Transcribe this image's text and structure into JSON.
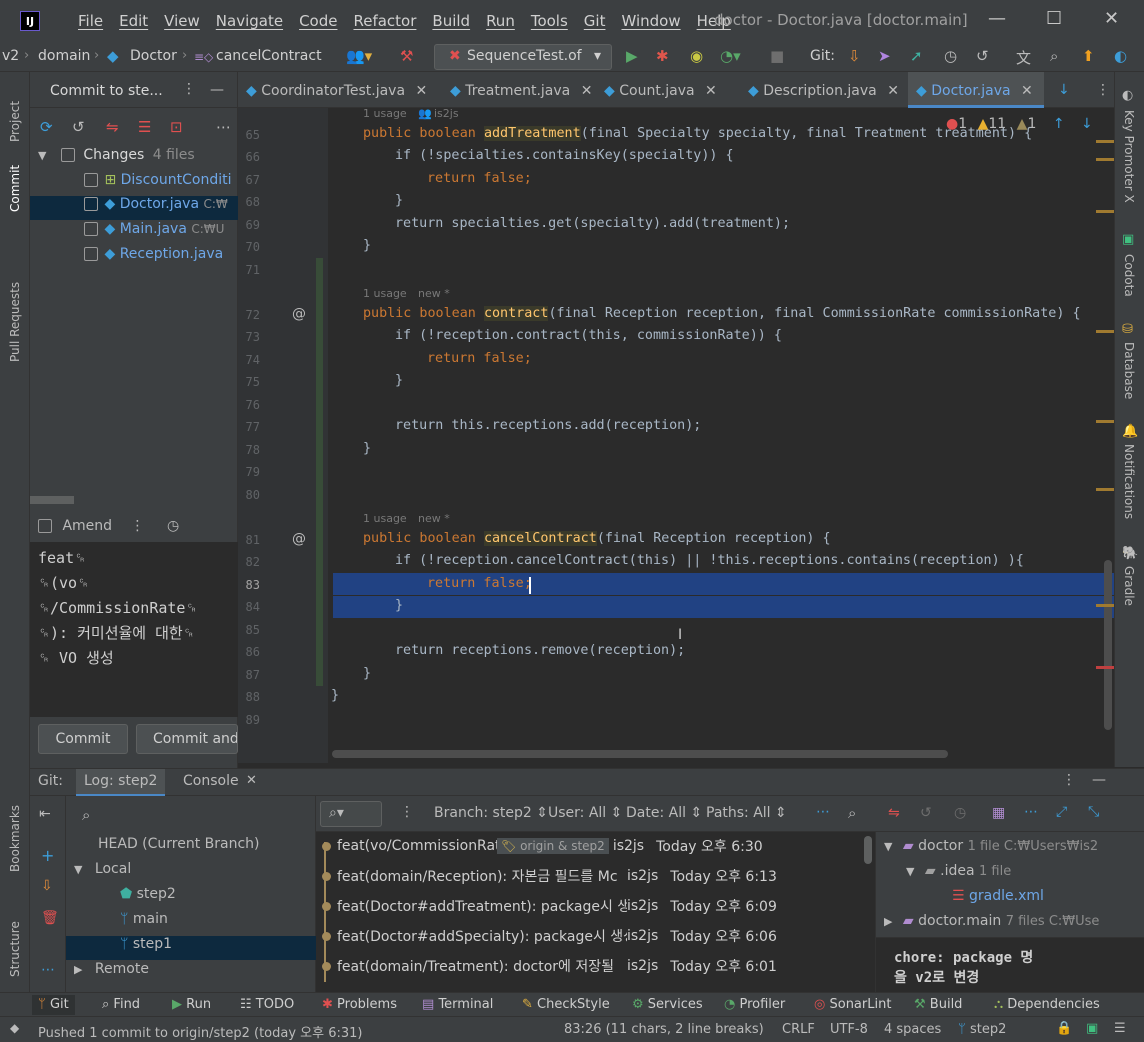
{
  "menu": [
    "File",
    "Edit",
    "View",
    "Navigate",
    "Code",
    "Refactor",
    "Build",
    "Run",
    "Tools",
    "Git",
    "Window",
    "Help"
  ],
  "window_title": "doctor - Doctor.java [doctor.main]",
  "breadcrumbs": [
    "v2",
    "domain",
    "Doctor",
    "cancelContract"
  ],
  "run_config": "SequenceTest.of",
  "git_label": "Git:",
  "left_strip": [
    "Project",
    "Commit",
    "Pull Requests",
    "Bookmarks",
    "Structure"
  ],
  "right_strip": [
    "Key Promoter X",
    "Codota",
    "Database",
    "Notifications",
    "Gradle"
  ],
  "commit_panel": {
    "title": "Commit to ste...",
    "changes_label": "Changes",
    "changes_count": "4 files",
    "files": [
      {
        "name": "DiscountConditi",
        "path": ""
      },
      {
        "name": "Doctor.java",
        "path": "C:₩"
      },
      {
        "name": "Main.java",
        "path": "C:₩U"
      },
      {
        "name": "Reception.java",
        "path": ""
      }
    ],
    "amend_label": "Amend",
    "message_lines": [
      "feat␍",
      "␍(vo␍",
      "␍/CommissionRate␍",
      "␍): 커미션율에 대한␍",
      "␍ VO 생성"
    ],
    "commit_button": "Commit",
    "commit_push_button": "Commit and"
  },
  "tabs": [
    "CoordinatorTest.java",
    "Treatment.java",
    "Count.java",
    "Description.java",
    "Doctor.java"
  ],
  "inspections": {
    "errors": "1",
    "warnings": "11",
    "weak": "1"
  },
  "code": {
    "line_numbers": [
      "65",
      "66",
      "67",
      "68",
      "69",
      "70",
      "71",
      "72",
      "73",
      "74",
      "75",
      "76",
      "77",
      "78",
      "79",
      "80",
      "81",
      "82",
      "83",
      "84",
      "85",
      "86",
      "87",
      "88",
      "89"
    ],
    "hints": {
      "h1_usage": "1 usage",
      "h1_author": "is2js",
      "h2_usage": "1 usage",
      "h2_new": "new *",
      "h3_usage": "1 usage",
      "h3_new": "new *"
    },
    "l65": {
      "kw1": "public boolean ",
      "fn": "addTreatment",
      "rest": "(final Specialty specialty, final Treatment treatment) {"
    },
    "l66": "if (!specialties.containsKey(specialty)) {",
    "l67": "return false;",
    "l68": "}",
    "l69": "return specialties.get(specialty).add(treatment);",
    "l70": "}",
    "l72": {
      "kw1": "public boolean ",
      "fn": "contract",
      "rest": "(final Reception reception, final CommissionRate commissionRate) {"
    },
    "l73": "if (!reception.contract(this, commissionRate)) {",
    "l74": "return false;",
    "l75": "}",
    "l77": "return this.receptions.add(reception);",
    "l78": "}",
    "l81": {
      "kw1": "public boolean ",
      "fn": "cancelContract",
      "rest": "(final Reception reception) {"
    },
    "l82": "if (!reception.cancelContract(this) || !this.receptions.contains(reception) ){",
    "l83": "return false;",
    "l84": "}",
    "l86": "return receptions.remove(reception);",
    "l87": "}",
    "l88": "}"
  },
  "bottom": {
    "git_label": "Git:",
    "tab_log": "Log: step2",
    "tab_console": "Console",
    "branches": {
      "head": "HEAD (Current Branch)",
      "local": "Local",
      "items": [
        "step2",
        "main",
        "step1"
      ],
      "remote": "Remote"
    },
    "filters": {
      "branch": "Branch: step2",
      "user": "User: All",
      "date": "Date: All",
      "paths": "Paths: All"
    },
    "commits": [
      {
        "msg": "feat(vo/CommissionRat",
        "tags": "origin & step2",
        "author": "is2js",
        "date": "Today 오후 6:30"
      },
      {
        "msg": "feat(domain/Reception): 자본금 필드를 Mc",
        "tags": "",
        "author": "is2js",
        "date": "Today 오후 6:13"
      },
      {
        "msg": "feat(Doctor#addTreatment): package시 생",
        "tags": "",
        "author": "is2js",
        "date": "Today 오후 6:09"
      },
      {
        "msg": "feat(Doctor#addSpecialty): package시 생성",
        "tags": "",
        "author": "is2js",
        "date": "Today 오후 6:06"
      },
      {
        "msg": "feat(domain/Treatment): doctor에 저장될",
        "tags": "",
        "author": "is2js",
        "date": "Today 오후 6:01"
      }
    ],
    "details": {
      "repo": "doctor",
      "repo_info": "1 file  C:₩Users₩is2",
      "idea": ".idea",
      "idea_info": "1 file",
      "file": "gradle.xml",
      "module": "doctor.main",
      "module_info": "7 files  C:₩Use",
      "message_line1": "chore: package 명",
      "message_line2": "을 v2로 변경"
    }
  },
  "toolwindows": [
    "Git",
    "Find",
    "Run",
    "TODO",
    "Problems",
    "Terminal",
    "CheckStyle",
    "Services",
    "Profiler",
    "SonarLint",
    "Build",
    "Dependencies"
  ],
  "status": {
    "message": "Pushed 1 commit to origin/step2 (today 오후 6:31)",
    "position": "83:26 (11 chars, 2 line breaks)",
    "line_sep": "CRLF",
    "encoding": "UTF-8",
    "indent": "4 spaces",
    "branch": "step2"
  },
  "colors": {
    "accent": "#4a88c7",
    "selection": "#214283",
    "keyword": "#cc7832",
    "method": "#ffc66d",
    "field": "#9876aa"
  }
}
